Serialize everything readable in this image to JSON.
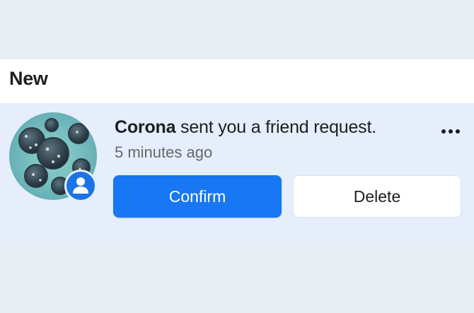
{
  "section": {
    "title": "New"
  },
  "notification": {
    "sender": "Corona",
    "message": " sent you a friend request.",
    "time": "5 minutes ago",
    "avatar_icon": "virus-avatar",
    "badge_icon": "person-icon",
    "more_icon": "ellipsis-icon",
    "confirm_label": "Confirm",
    "delete_label": "Delete"
  },
  "colors": {
    "confirm_bg": "#1877f2",
    "badge_bg": "#1b74e4",
    "row_bg": "#e5eefa",
    "header_bg": "#ffffff",
    "text": "#1c1e21",
    "muted_text": "#65676b"
  }
}
